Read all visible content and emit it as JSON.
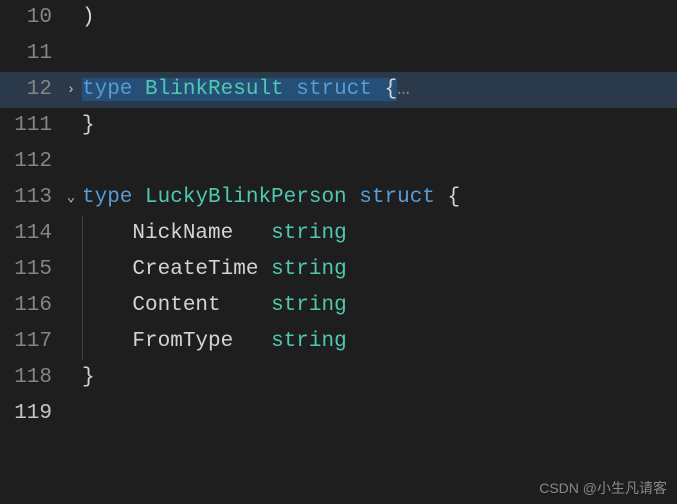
{
  "watermark": "CSDN @小生凡请客",
  "lines": {
    "l10": {
      "num": "10",
      "paren": ")"
    },
    "l11": {
      "num": "11"
    },
    "l12": {
      "num": "12",
      "fold": "›",
      "kw_type": "type",
      "name": "BlinkResult",
      "kw_struct": "struct",
      "brace": " {",
      "ellipsis": "…"
    },
    "l111": {
      "num": "111",
      "brace": "}"
    },
    "l112": {
      "num": "112"
    },
    "l113": {
      "num": "113",
      "fold": "⌄",
      "kw_type": "type",
      "name": "LuckyBlinkPerson",
      "kw_struct": "struct",
      "brace": " {"
    },
    "l114": {
      "num": "114",
      "field": "NickName  ",
      "ftype": "string"
    },
    "l115": {
      "num": "115",
      "field": "CreateTime",
      "ftype": "string"
    },
    "l116": {
      "num": "116",
      "field": "Content   ",
      "ftype": "string"
    },
    "l117": {
      "num": "117",
      "field": "FromType  ",
      "ftype": "string"
    },
    "l118": {
      "num": "118",
      "brace": "}"
    },
    "l119": {
      "num": "119"
    }
  }
}
